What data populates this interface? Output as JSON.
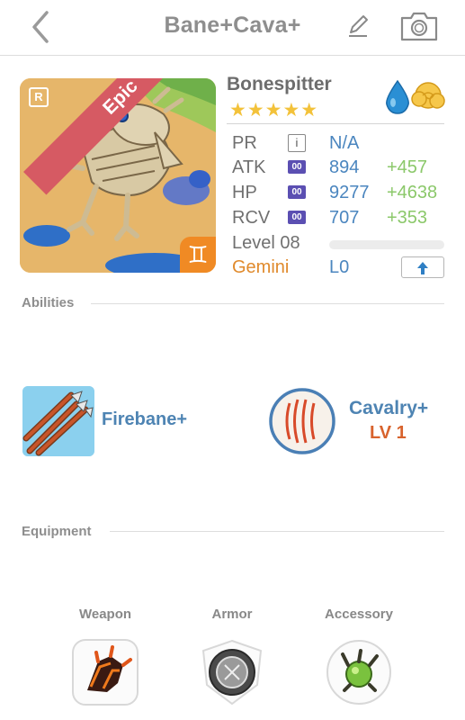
{
  "header": {
    "title": "Bane+Cava+"
  },
  "monster": {
    "name": "Bonespitter",
    "rarity": "Epic",
    "rank_badge": "R",
    "stars": "★★★★★",
    "star_count": 5,
    "zodiac_glyph": "♊",
    "elements": [
      "water-drop-icon",
      "cloud-icon"
    ]
  },
  "stats": {
    "pr": {
      "label": "PR",
      "icon": "i",
      "value": "N/A"
    },
    "atk": {
      "label": "ATK",
      "chip": "00",
      "value": "894",
      "bonus": "+457"
    },
    "hp": {
      "label": "HP",
      "chip": "00",
      "value": "9277",
      "bonus": "+4638"
    },
    "rcv": {
      "label": "RCV",
      "chip": "00",
      "value": "707",
      "bonus": "+353"
    },
    "level": {
      "label": "Level 08"
    },
    "sign": {
      "label": "Gemini",
      "value": "L0",
      "button_glyph": "🡅"
    }
  },
  "abilities": {
    "header": "Abilities",
    "items": [
      {
        "name": "Firebane+"
      },
      {
        "name": "Cavalry+",
        "level": "LV 1"
      }
    ]
  },
  "equipment": {
    "header": "Equipment",
    "slots": [
      {
        "label": "Weapon"
      },
      {
        "label": "Armor"
      },
      {
        "label": "Accessory"
      }
    ]
  },
  "colors": {
    "accent_blue": "#4e84b3",
    "bonus_green": "#8bc86a",
    "rarity_red": "#d65a63",
    "gemini_orange": "#e08a2c",
    "star_gold": "#f3c23a"
  }
}
